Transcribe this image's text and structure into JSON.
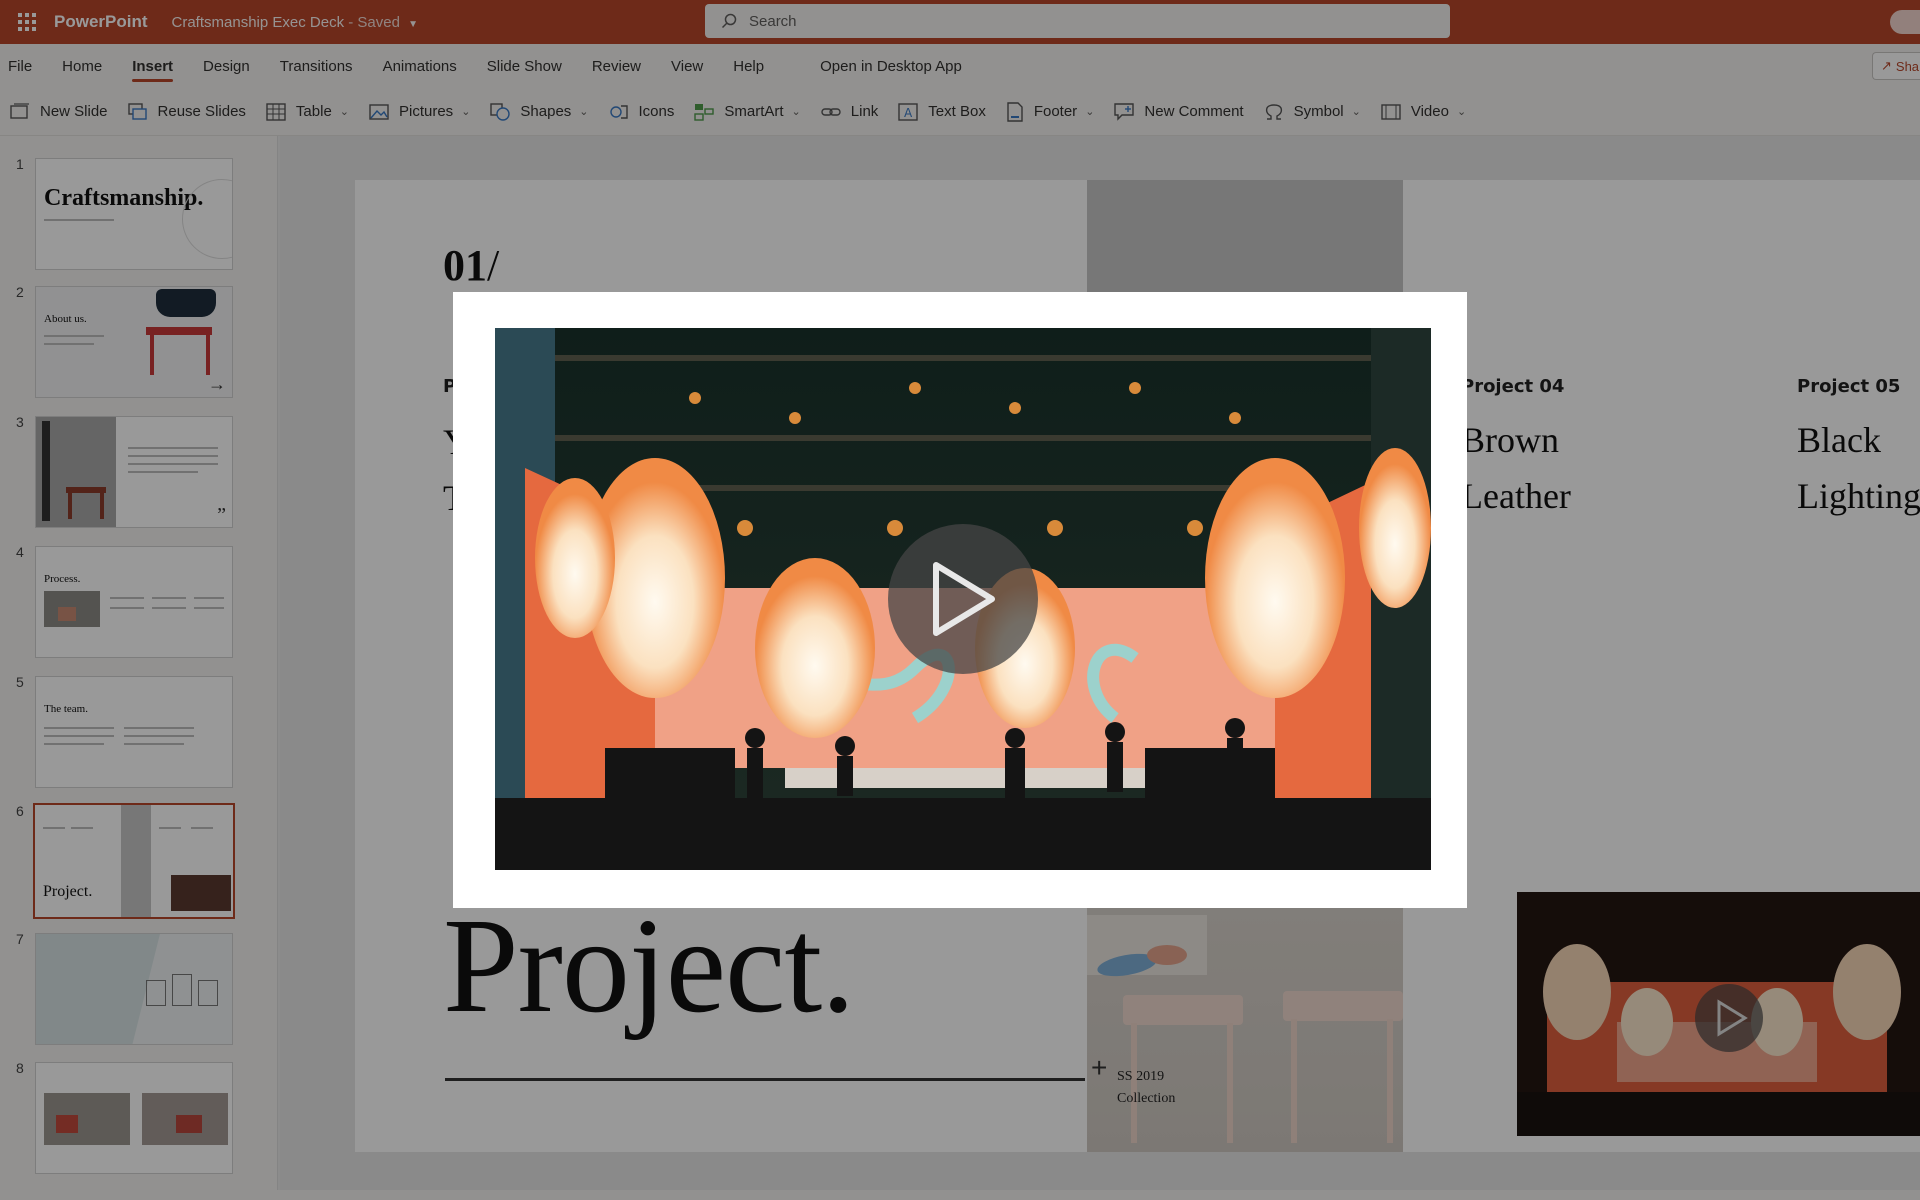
{
  "app": {
    "name": "PowerPoint",
    "document_title": "Craftsmanship Exec Deck",
    "save_status": "- Saved",
    "accent": "#b7472a"
  },
  "search": {
    "placeholder": "Search"
  },
  "menu": {
    "tabs": [
      "File",
      "Home",
      "Insert",
      "Design",
      "Transitions",
      "Animations",
      "Slide Show",
      "Review",
      "View",
      "Help"
    ],
    "active_tab": "Insert",
    "open_desktop": "Open in Desktop App",
    "share": "Sha"
  },
  "ribbon": {
    "new_slide": "New Slide",
    "reuse_slides": "Reuse Slides",
    "table": "Table",
    "pictures": "Pictures",
    "shapes": "Shapes",
    "icons": "Icons",
    "smartart": "SmartArt",
    "link": "Link",
    "text_box": "Text Box",
    "footer": "Footer",
    "new_comment": "New Comment",
    "symbol": "Symbol",
    "video": "Video"
  },
  "thumbnails": [
    {
      "num": "1",
      "title": "Craftsmanship."
    },
    {
      "num": "2",
      "title": "About us."
    },
    {
      "num": "3",
      "title": ""
    },
    {
      "num": "4",
      "title": "Process."
    },
    {
      "num": "5",
      "title": "The team."
    },
    {
      "num": "6",
      "title": "Project.",
      "selected": true
    },
    {
      "num": "7",
      "title": ""
    },
    {
      "num": "8",
      "title": ""
    }
  ],
  "slide": {
    "number": "01",
    "slash": "/",
    "left_label_fragment": "P",
    "left_name_fragment_1": "Y",
    "left_name_fragment_2": "T",
    "project4_label": "Project 04",
    "project4_line1": "Brown",
    "project4_line2": "Leather",
    "project5_label": "Project 05",
    "project5_line1": "Black",
    "project5_line2": "Lighting",
    "title": "Project.",
    "collection_line1": "SS 2019",
    "collection_line2": "Collection"
  },
  "modal": {
    "content": "video-player"
  }
}
